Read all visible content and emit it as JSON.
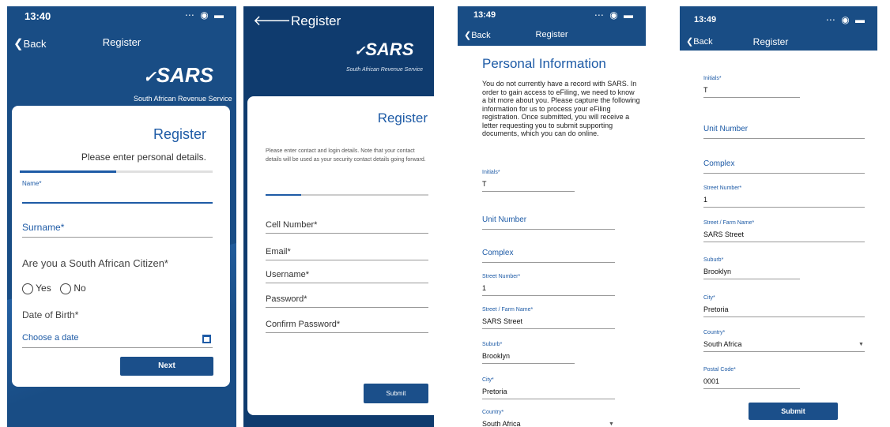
{
  "panel1": {
    "time": "13:40",
    "back": "Back",
    "nav_title": "Register",
    "logo": "SARS",
    "logo_sub": "South African Revenue Service",
    "title": "Register",
    "subtitle": "Please enter personal details.",
    "name_label": "Name*",
    "surname_label": "Surname*",
    "citizen_q": "Are you a South African Citizen*",
    "yes": "Yes",
    "no": "No",
    "dob_label": "Date of Birth*",
    "dob_placeholder": "Choose a date",
    "next": "Next",
    "progress": 0.5
  },
  "panel2": {
    "nav_title": "Register",
    "logo": "SARS",
    "logo_sub": "South African Revenue Service",
    "title": "Register",
    "desc": "Please enter contact and login details. Note that your contact details will be used as your security contact details going forward.",
    "fields": [
      "Cell Number*",
      "Email*",
      "Username*",
      "Password*",
      "Confirm Password*"
    ],
    "submit": "Submit",
    "progress": 0.22
  },
  "panel3": {
    "time": "13:49",
    "back": "Back",
    "nav_title": "Register",
    "heading": "Personal Information",
    "intro": "You do not currently have a record with SARS. In order to gain access to eFiling, we need to know a bit more about you. Please capture the following information for us to process your eFiling registration. Once submitted, you will receive a letter requesting you to submit supporting documents, which you can do online.",
    "initials_label": "Initials*",
    "initials_value": "T",
    "unit": "Unit Number",
    "complex": "Complex",
    "street_no_label": "Street Number*",
    "street_no_value": "1",
    "street_label": "Street / Farm Name*",
    "street_value": "SARS Street",
    "suburb_label": "Suburb*",
    "suburb_value": "Brooklyn",
    "city_label": "City*",
    "city_value": "Pretoria",
    "country_label": "Country*",
    "country_value": "South Africa"
  },
  "panel4": {
    "time": "13:49",
    "back": "Back",
    "nav_title": "Register",
    "initials_label": "Initials*",
    "initials_value": "T",
    "unit": "Unit Number",
    "complex": "Complex",
    "street_no_label": "Street Number*",
    "street_no_value": "1",
    "street_label": "Street / Farm Name*",
    "street_value": "SARS Street",
    "suburb_label": "Suburb*",
    "suburb_value": "Brooklyn",
    "city_label": "City*",
    "city_value": "Pretoria",
    "country_label": "Country*",
    "country_value": "South Africa",
    "postal_label": "Postal Code*",
    "postal_value": "0001",
    "submit": "Submit"
  }
}
